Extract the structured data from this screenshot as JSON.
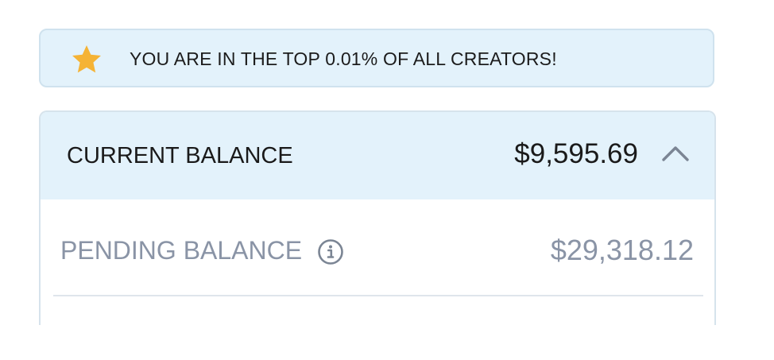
{
  "banner": {
    "icon": "star-icon",
    "icon_color": "#f5b335",
    "text": "YOU ARE IN THE TOP 0.01% OF ALL CREATORS!"
  },
  "balance_card": {
    "current": {
      "label": "CURRENT BALANCE",
      "amount": "$9,595.69",
      "toggle_icon": "chevron-up-icon",
      "expanded": true
    },
    "pending": {
      "label": "PENDING BALANCE",
      "info_icon": "info-icon",
      "amount": "$29,318.12"
    }
  },
  "colors": {
    "highlight_background": "#e3f2fb",
    "primary_text": "#1a1a1a",
    "muted_text": "#8a94a6",
    "border": "#d6e3ec"
  }
}
